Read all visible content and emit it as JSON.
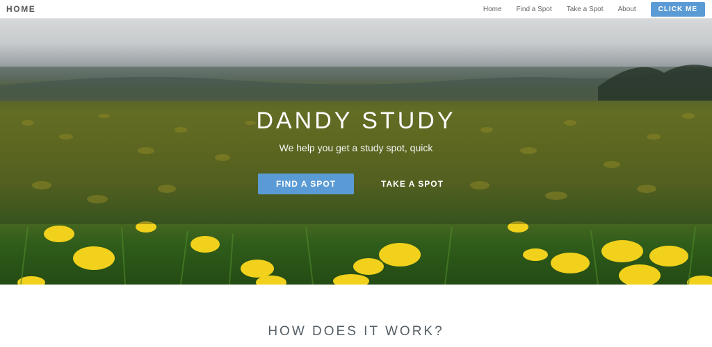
{
  "navbar": {
    "brand": "HOME",
    "links": [
      "Home",
      "Find a Spot",
      "Take a Spot",
      "About"
    ],
    "cta": "CLICK ME"
  },
  "hero": {
    "title": "DANDY STUDY",
    "subtitle": "We help you get a study spot, quick",
    "primary_button": "FIND A SPOT",
    "secondary_button": "TAKE A SPOT",
    "background": "dandelion-field"
  },
  "section": {
    "title": "HOW DOES IT WORK?"
  },
  "colors": {
    "accent": "#5b9bd5",
    "nav_text": "#666666",
    "section_text": "#555f66"
  }
}
